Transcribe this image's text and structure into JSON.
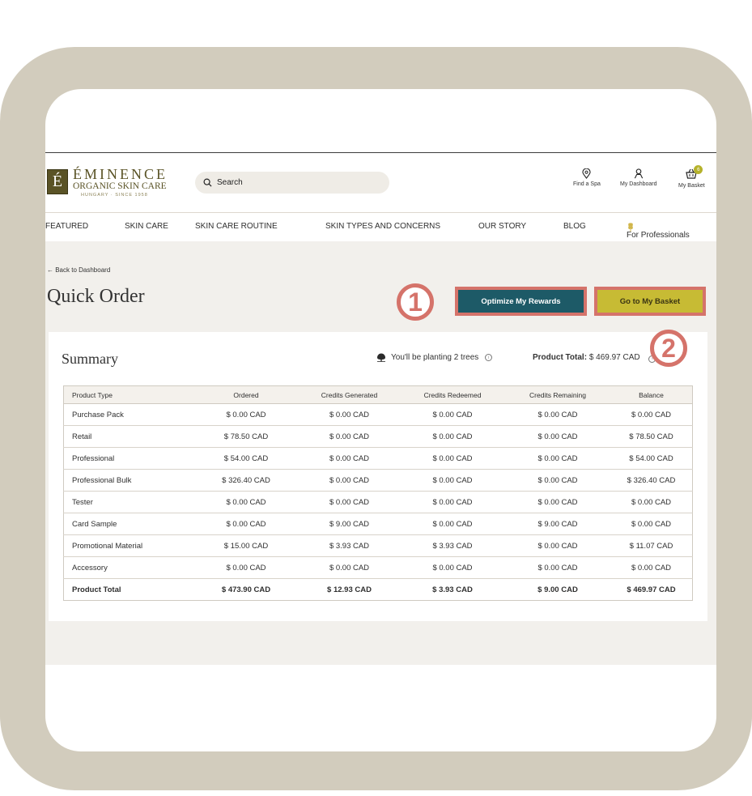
{
  "brand": {
    "letter": "É",
    "name": "ÉMINENCE",
    "tagline": "ORGANIC SKIN CARE",
    "since": "HUNGARY · SINCE 1958"
  },
  "header": {
    "search_placeholder": "Search",
    "find_spa": "Find a Spa",
    "dashboard": "My Dashboard",
    "basket": "My Basket",
    "basket_count": "6"
  },
  "nav": [
    "FEATURED",
    "SKIN CARE",
    "SKIN CARE ROUTINE",
    "SKIN TYPES AND CONCERNS",
    "OUR STORY",
    "BLOG",
    "For Professionals"
  ],
  "page": {
    "back_link": "← Back to Dashboard",
    "title": "Quick Order",
    "optimize_button": "Optimize My Rewards",
    "basket_button": "Go to My Basket",
    "callout_1": "1",
    "callout_2": "2"
  },
  "summary": {
    "title": "Summary",
    "trees_text": "You'll be planting 2 trees",
    "product_total_label": "Product Total:",
    "product_total_value": "$ 469.97 CAD",
    "columns": [
      "Product Type",
      "Ordered",
      "Credits Generated",
      "Credits Redeemed",
      "Credits Remaining",
      "Balance"
    ],
    "rows": [
      [
        "Purchase Pack",
        "$ 0.00 CAD",
        "$ 0.00 CAD",
        "$ 0.00 CAD",
        "$ 0.00 CAD",
        "$ 0.00 CAD"
      ],
      [
        "Retail",
        "$ 78.50 CAD",
        "$ 0.00 CAD",
        "$ 0.00 CAD",
        "$ 0.00 CAD",
        "$ 78.50 CAD"
      ],
      [
        "Professional",
        "$ 54.00 CAD",
        "$ 0.00 CAD",
        "$ 0.00 CAD",
        "$ 0.00 CAD",
        "$ 54.00 CAD"
      ],
      [
        "Professional Bulk",
        "$ 326.40 CAD",
        "$ 0.00 CAD",
        "$ 0.00 CAD",
        "$ 0.00 CAD",
        "$ 326.40 CAD"
      ],
      [
        "Tester",
        "$ 0.00 CAD",
        "$ 0.00 CAD",
        "$ 0.00 CAD",
        "$ 0.00 CAD",
        "$ 0.00 CAD"
      ],
      [
        "Card Sample",
        "$ 0.00 CAD",
        "$ 9.00 CAD",
        "$ 0.00 CAD",
        "$ 9.00 CAD",
        "$ 0.00 CAD"
      ],
      [
        "Promotional Material",
        "$ 15.00 CAD",
        "$ 3.93 CAD",
        "$ 3.93 CAD",
        "$ 0.00 CAD",
        "$ 11.07 CAD"
      ],
      [
        "Accessory",
        "$ 0.00 CAD",
        "$ 0.00 CAD",
        "$ 0.00 CAD",
        "$ 0.00 CAD",
        "$ 0.00 CAD"
      ]
    ],
    "total_row": [
      "Product Total",
      "$ 473.90 CAD",
      "$ 12.93 CAD",
      "$ 3.93 CAD",
      "$ 9.00 CAD",
      "$ 469.97 CAD"
    ]
  },
  "colors": {
    "frame": "#d2ccbd",
    "brand_olive": "#5a5326",
    "optimize_teal": "#1d5a67",
    "basket_yellow": "#c7bb34",
    "callout_red": "#d5736a"
  }
}
